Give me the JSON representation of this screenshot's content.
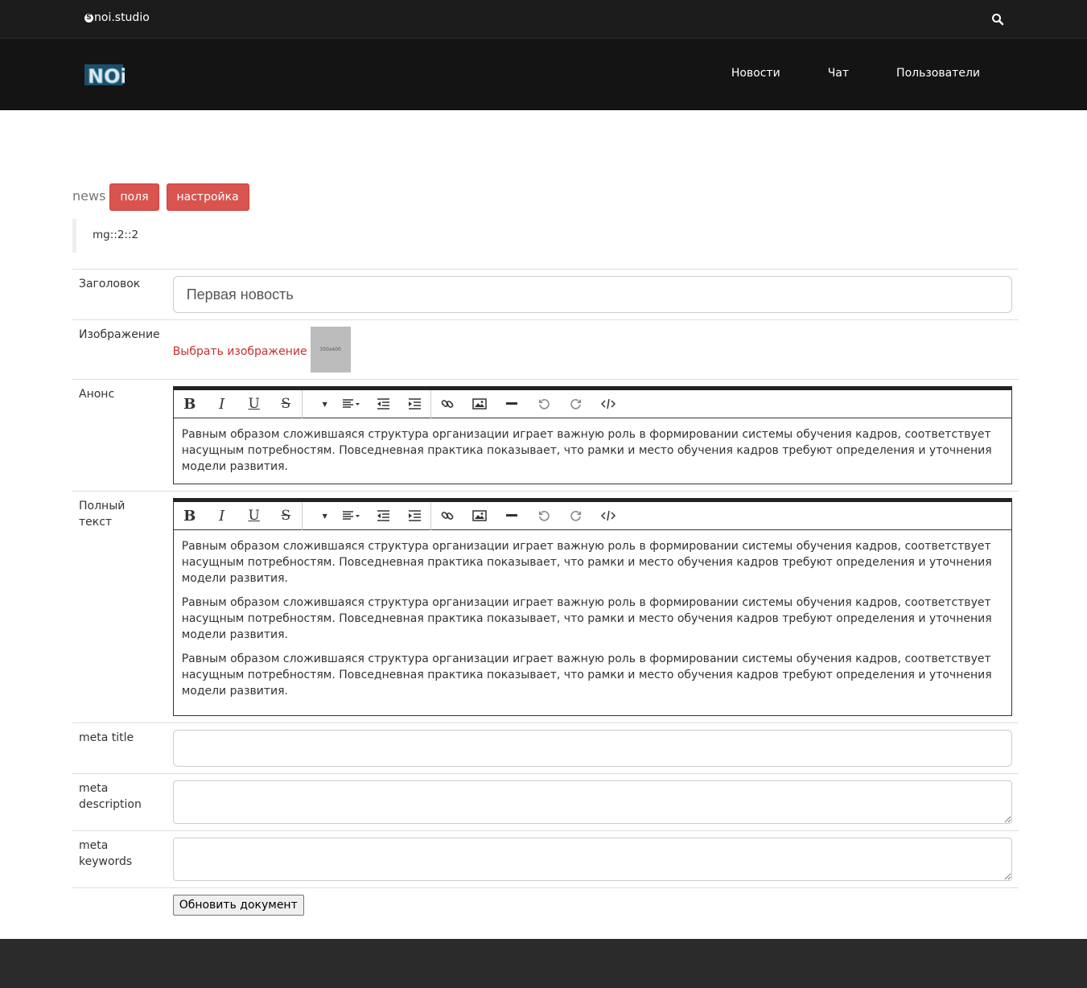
{
  "topbar": {
    "brand": "noi.studio",
    "search_icon": "search-icon"
  },
  "nav": {
    "logo_text": "NOi",
    "items": [
      "Новости",
      "Чат",
      "Пользователи"
    ]
  },
  "header": {
    "label": "news",
    "btn_fields": "поля",
    "btn_settings": "настройка"
  },
  "quote": "mg::2::2",
  "form": {
    "title_label": "Заголовок",
    "title_value": "Первая новость",
    "image_label": "Изображение",
    "image_link": "Выбрать изображение",
    "image_thumb": "350x400",
    "announce_label": "Анонс",
    "announce_text": "Равным образом сложившаяся структура организации играет важную роль в формировании системы обучения кадров, соответствует насущным потребностям. Повседневная практика показывает, что рамки и место обучения кадров требуют определения и уточнения модели развития.",
    "fulltext_label": "Полный текст",
    "fulltext_paragraphs": [
      "Равным образом сложившаяся структура организации играет важную роль в формировании системы обучения кадров, соответствует насущным потребностям. Повседневная практика показывает, что рамки и место обучения кадров требуют определения и уточнения модели развития.",
      "Равным образом сложившаяся структура организации играет важную роль в формировании системы обучения кадров, соответствует насущным потребностям. Повседневная практика показывает, что рамки и место обучения кадров требуют определения и уточнения модели развития.",
      "Равным образом сложившаяся структура организации играет важную роль в формировании системы обучения кадров, соответствует насущным потребностям. Повседневная практика показывает, что рамки и место обучения кадров требуют определения и уточнения модели развития."
    ],
    "meta_title_label": "meta title",
    "meta_description_label_1": "meta",
    "meta_description_label_2": "description",
    "meta_keywords_label_1": "meta",
    "meta_keywords_label_2": "keywords",
    "submit": "Обновить документ"
  },
  "toolbar_icons": [
    "bold-icon",
    "italic-icon",
    "underline-icon",
    "strikethrough-icon",
    "font-size-dropdown-icon",
    "align-dropdown-icon",
    "outdent-icon",
    "indent-icon",
    "link-icon",
    "image-icon",
    "horizontal-rule-icon",
    "undo-icon",
    "redo-icon",
    "code-view-icon"
  ],
  "colors": {
    "topbar": "#1c1c1c",
    "navbar": "#141414",
    "accent_red": "#d9534f",
    "link_red": "#c9302c",
    "footer": "#2b2b2b"
  }
}
